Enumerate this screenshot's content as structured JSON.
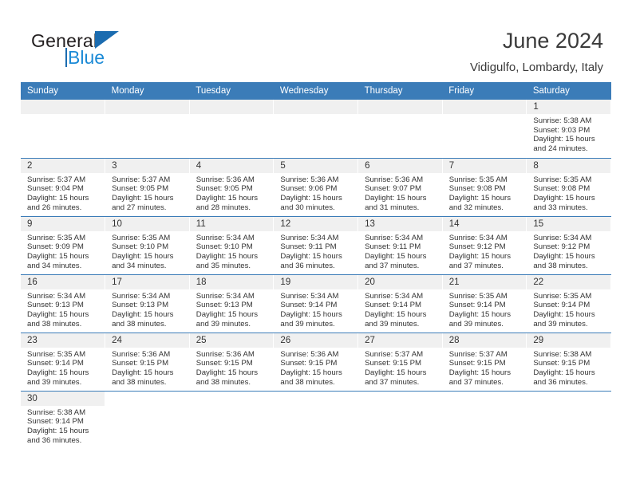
{
  "brand": {
    "name_top": "General",
    "name_bottom": "Blue",
    "triangle_color": "#1b6cb0",
    "blue_color": "#1b8ad6"
  },
  "header": {
    "title": "June 2024",
    "location": "Vidigulfo, Lombardy, Italy"
  },
  "theme": {
    "header_bg": "#3b7cb8",
    "header_text": "#ffffff",
    "daynum_band_bg": "#f0f0f0",
    "row_separator": "#3b7cb8"
  },
  "weekdays": [
    "Sunday",
    "Monday",
    "Tuesday",
    "Wednesday",
    "Thursday",
    "Friday",
    "Saturday"
  ],
  "labels": {
    "sunrise_prefix": "Sunrise: ",
    "sunset_prefix": "Sunset: ",
    "daylight_prefix": "Daylight: "
  },
  "weeks": [
    [
      {
        "empty": true
      },
      {
        "empty": true
      },
      {
        "empty": true
      },
      {
        "empty": true
      },
      {
        "empty": true
      },
      {
        "empty": true
      },
      {
        "day": "1",
        "sunrise": "Sunrise: 5:38 AM",
        "sunset": "Sunset: 9:03 PM",
        "daylight_line1": "Daylight: 15 hours",
        "daylight_line2": "and 24 minutes."
      }
    ],
    [
      {
        "day": "2",
        "sunrise": "Sunrise: 5:37 AM",
        "sunset": "Sunset: 9:04 PM",
        "daylight_line1": "Daylight: 15 hours",
        "daylight_line2": "and 26 minutes."
      },
      {
        "day": "3",
        "sunrise": "Sunrise: 5:37 AM",
        "sunset": "Sunset: 9:05 PM",
        "daylight_line1": "Daylight: 15 hours",
        "daylight_line2": "and 27 minutes."
      },
      {
        "day": "4",
        "sunrise": "Sunrise: 5:36 AM",
        "sunset": "Sunset: 9:05 PM",
        "daylight_line1": "Daylight: 15 hours",
        "daylight_line2": "and 28 minutes."
      },
      {
        "day": "5",
        "sunrise": "Sunrise: 5:36 AM",
        "sunset": "Sunset: 9:06 PM",
        "daylight_line1": "Daylight: 15 hours",
        "daylight_line2": "and 30 minutes."
      },
      {
        "day": "6",
        "sunrise": "Sunrise: 5:36 AM",
        "sunset": "Sunset: 9:07 PM",
        "daylight_line1": "Daylight: 15 hours",
        "daylight_line2": "and 31 minutes."
      },
      {
        "day": "7",
        "sunrise": "Sunrise: 5:35 AM",
        "sunset": "Sunset: 9:08 PM",
        "daylight_line1": "Daylight: 15 hours",
        "daylight_line2": "and 32 minutes."
      },
      {
        "day": "8",
        "sunrise": "Sunrise: 5:35 AM",
        "sunset": "Sunset: 9:08 PM",
        "daylight_line1": "Daylight: 15 hours",
        "daylight_line2": "and 33 minutes."
      }
    ],
    [
      {
        "day": "9",
        "sunrise": "Sunrise: 5:35 AM",
        "sunset": "Sunset: 9:09 PM",
        "daylight_line1": "Daylight: 15 hours",
        "daylight_line2": "and 34 minutes."
      },
      {
        "day": "10",
        "sunrise": "Sunrise: 5:35 AM",
        "sunset": "Sunset: 9:10 PM",
        "daylight_line1": "Daylight: 15 hours",
        "daylight_line2": "and 34 minutes."
      },
      {
        "day": "11",
        "sunrise": "Sunrise: 5:34 AM",
        "sunset": "Sunset: 9:10 PM",
        "daylight_line1": "Daylight: 15 hours",
        "daylight_line2": "and 35 minutes."
      },
      {
        "day": "12",
        "sunrise": "Sunrise: 5:34 AM",
        "sunset": "Sunset: 9:11 PM",
        "daylight_line1": "Daylight: 15 hours",
        "daylight_line2": "and 36 minutes."
      },
      {
        "day": "13",
        "sunrise": "Sunrise: 5:34 AM",
        "sunset": "Sunset: 9:11 PM",
        "daylight_line1": "Daylight: 15 hours",
        "daylight_line2": "and 37 minutes."
      },
      {
        "day": "14",
        "sunrise": "Sunrise: 5:34 AM",
        "sunset": "Sunset: 9:12 PM",
        "daylight_line1": "Daylight: 15 hours",
        "daylight_line2": "and 37 minutes."
      },
      {
        "day": "15",
        "sunrise": "Sunrise: 5:34 AM",
        "sunset": "Sunset: 9:12 PM",
        "daylight_line1": "Daylight: 15 hours",
        "daylight_line2": "and 38 minutes."
      }
    ],
    [
      {
        "day": "16",
        "sunrise": "Sunrise: 5:34 AM",
        "sunset": "Sunset: 9:13 PM",
        "daylight_line1": "Daylight: 15 hours",
        "daylight_line2": "and 38 minutes."
      },
      {
        "day": "17",
        "sunrise": "Sunrise: 5:34 AM",
        "sunset": "Sunset: 9:13 PM",
        "daylight_line1": "Daylight: 15 hours",
        "daylight_line2": "and 38 minutes."
      },
      {
        "day": "18",
        "sunrise": "Sunrise: 5:34 AM",
        "sunset": "Sunset: 9:13 PM",
        "daylight_line1": "Daylight: 15 hours",
        "daylight_line2": "and 39 minutes."
      },
      {
        "day": "19",
        "sunrise": "Sunrise: 5:34 AM",
        "sunset": "Sunset: 9:14 PM",
        "daylight_line1": "Daylight: 15 hours",
        "daylight_line2": "and 39 minutes."
      },
      {
        "day": "20",
        "sunrise": "Sunrise: 5:34 AM",
        "sunset": "Sunset: 9:14 PM",
        "daylight_line1": "Daylight: 15 hours",
        "daylight_line2": "and 39 minutes."
      },
      {
        "day": "21",
        "sunrise": "Sunrise: 5:35 AM",
        "sunset": "Sunset: 9:14 PM",
        "daylight_line1": "Daylight: 15 hours",
        "daylight_line2": "and 39 minutes."
      },
      {
        "day": "22",
        "sunrise": "Sunrise: 5:35 AM",
        "sunset": "Sunset: 9:14 PM",
        "daylight_line1": "Daylight: 15 hours",
        "daylight_line2": "and 39 minutes."
      }
    ],
    [
      {
        "day": "23",
        "sunrise": "Sunrise: 5:35 AM",
        "sunset": "Sunset: 9:14 PM",
        "daylight_line1": "Daylight: 15 hours",
        "daylight_line2": "and 39 minutes."
      },
      {
        "day": "24",
        "sunrise": "Sunrise: 5:36 AM",
        "sunset": "Sunset: 9:15 PM",
        "daylight_line1": "Daylight: 15 hours",
        "daylight_line2": "and 38 minutes."
      },
      {
        "day": "25",
        "sunrise": "Sunrise: 5:36 AM",
        "sunset": "Sunset: 9:15 PM",
        "daylight_line1": "Daylight: 15 hours",
        "daylight_line2": "and 38 minutes."
      },
      {
        "day": "26",
        "sunrise": "Sunrise: 5:36 AM",
        "sunset": "Sunset: 9:15 PM",
        "daylight_line1": "Daylight: 15 hours",
        "daylight_line2": "and 38 minutes."
      },
      {
        "day": "27",
        "sunrise": "Sunrise: 5:37 AM",
        "sunset": "Sunset: 9:15 PM",
        "daylight_line1": "Daylight: 15 hours",
        "daylight_line2": "and 37 minutes."
      },
      {
        "day": "28",
        "sunrise": "Sunrise: 5:37 AM",
        "sunset": "Sunset: 9:15 PM",
        "daylight_line1": "Daylight: 15 hours",
        "daylight_line2": "and 37 minutes."
      },
      {
        "day": "29",
        "sunrise": "Sunrise: 5:38 AM",
        "sunset": "Sunset: 9:15 PM",
        "daylight_line1": "Daylight: 15 hours",
        "daylight_line2": "and 36 minutes."
      }
    ],
    [
      {
        "day": "30",
        "sunrise": "Sunrise: 5:38 AM",
        "sunset": "Sunset: 9:14 PM",
        "daylight_line1": "Daylight: 15 hours",
        "daylight_line2": "and 36 minutes."
      },
      {
        "blank": true
      },
      {
        "blank": true
      },
      {
        "blank": true
      },
      {
        "blank": true
      },
      {
        "blank": true
      },
      {
        "blank": true
      }
    ]
  ]
}
